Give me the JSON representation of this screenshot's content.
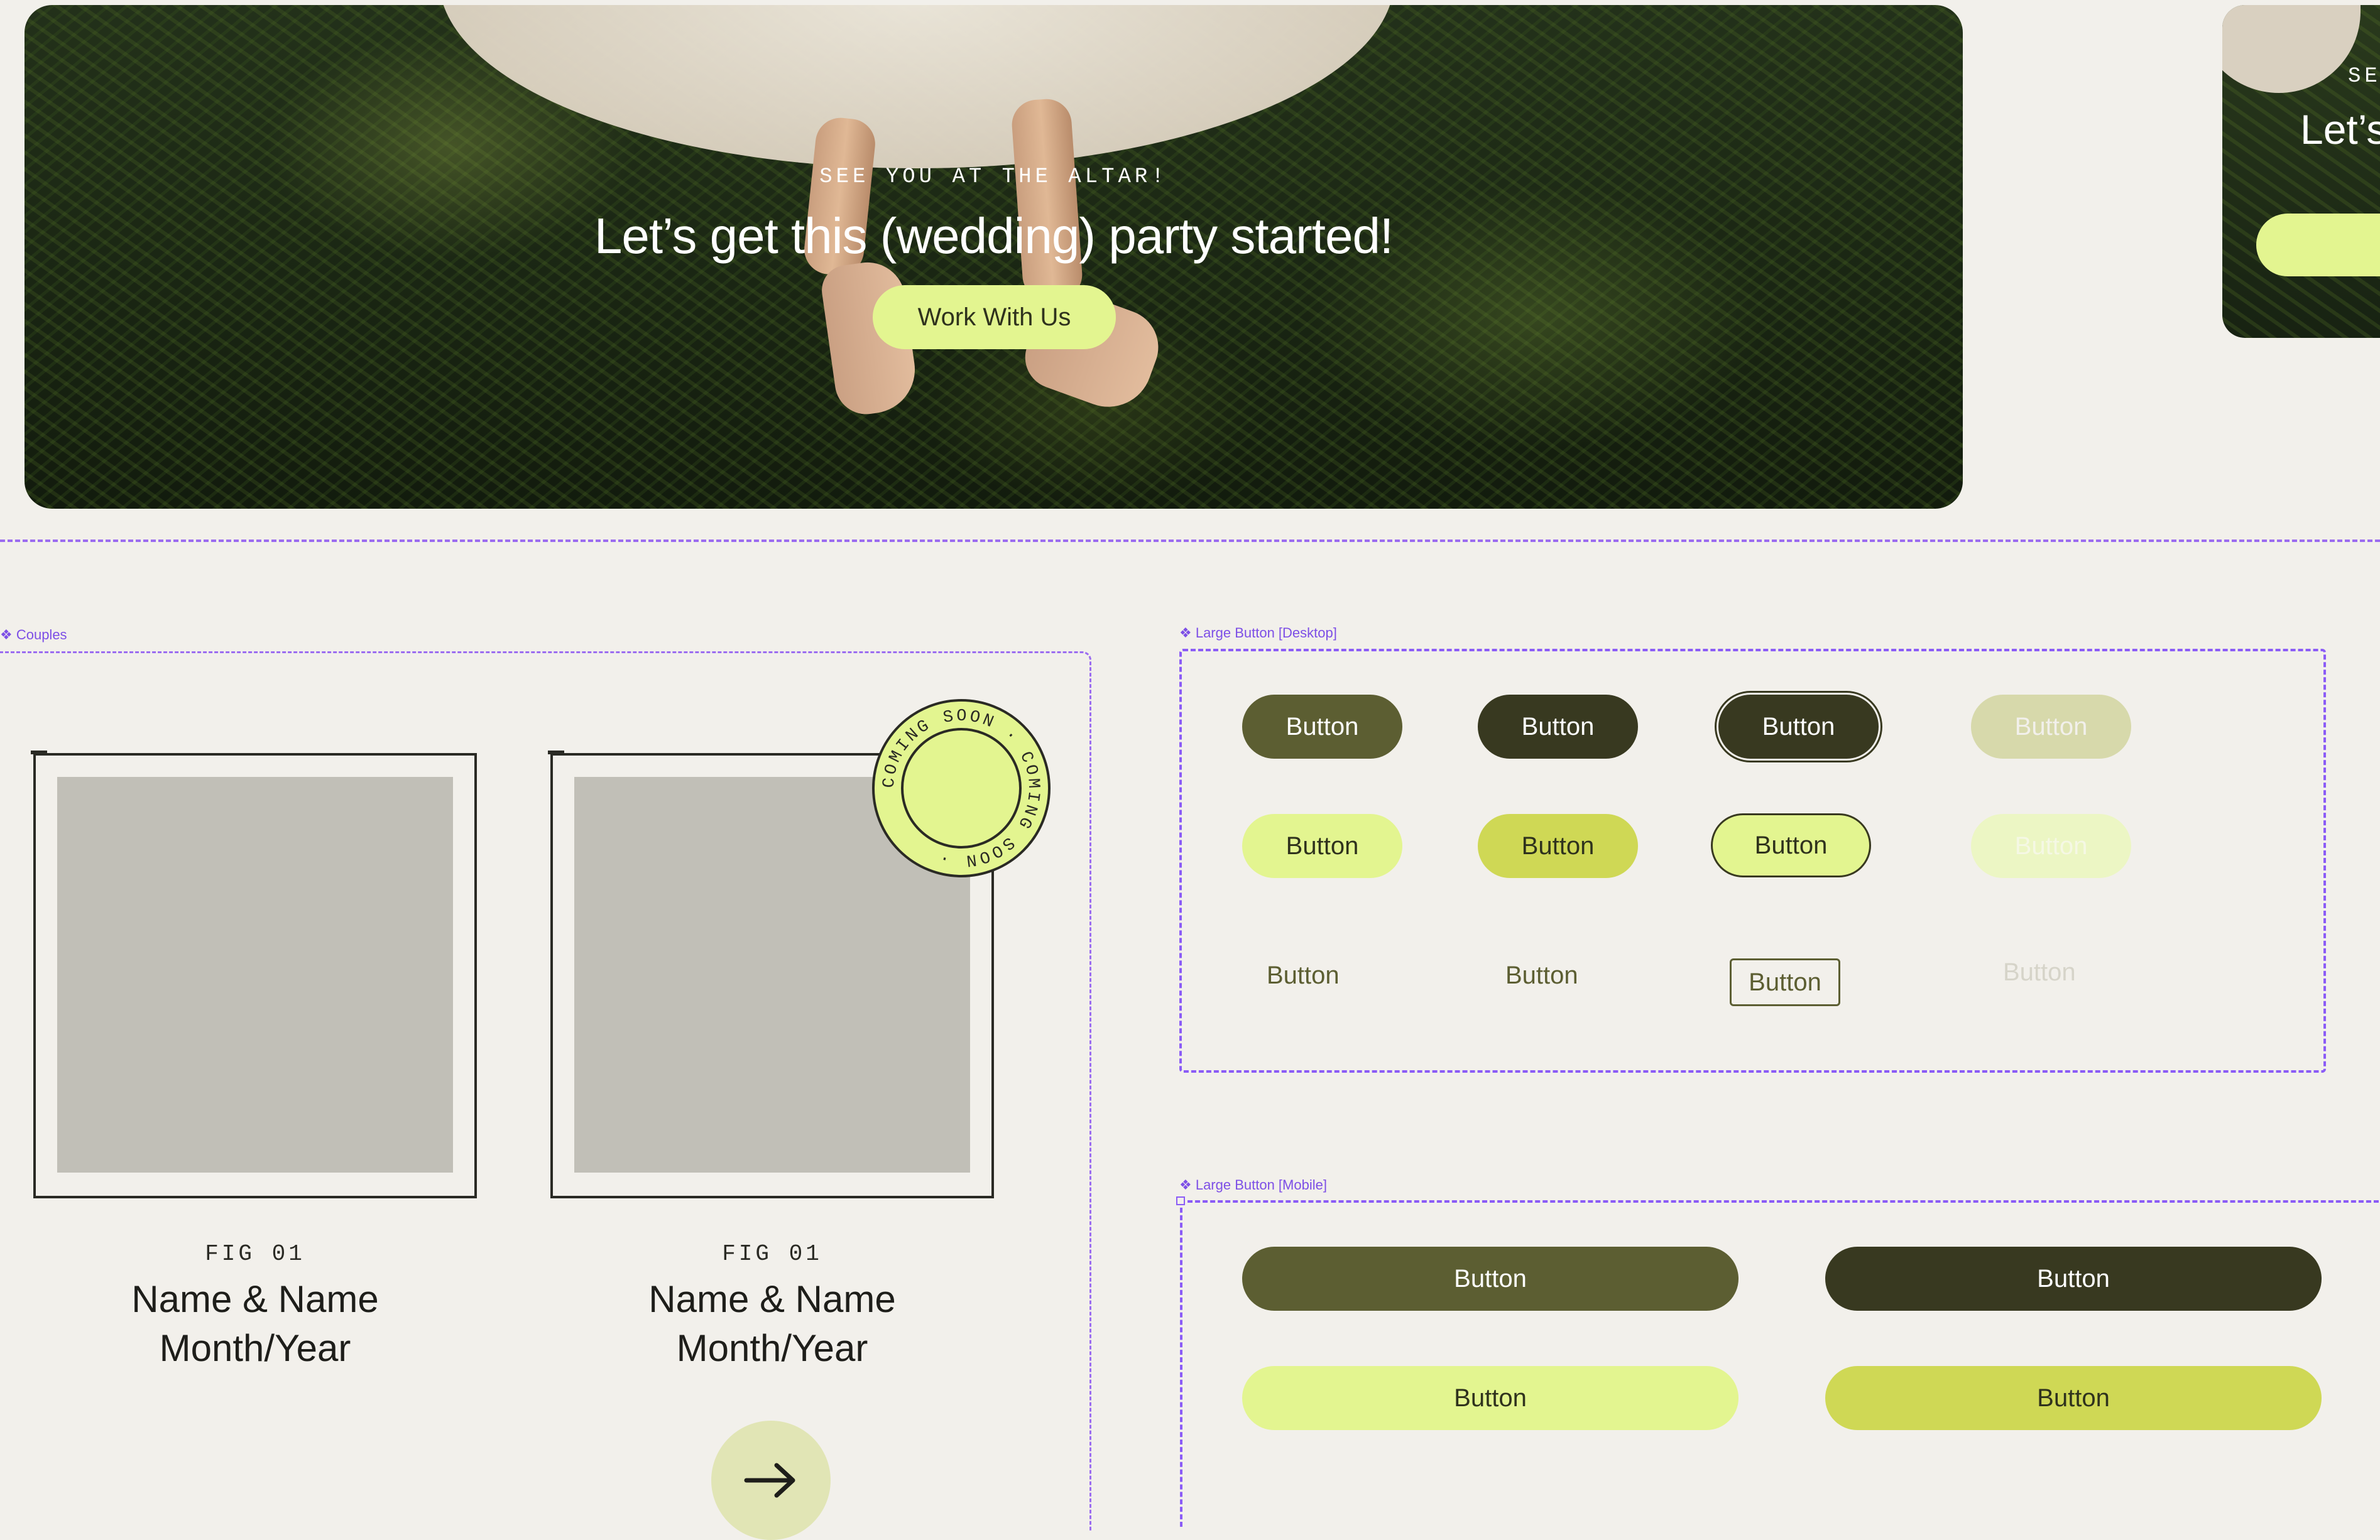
{
  "hero": {
    "eyebrow": "SEE YOU AT THE ALTAR!",
    "title": "Let’s get this (wedding) party started!",
    "cta_label": "Work With Us"
  },
  "hero_partial": {
    "eyebrow": "SEE",
    "title": "Let’s"
  },
  "frames": {
    "couples_label": "❖ Couples",
    "large_desktop_label": "❖ Large Button [Desktop]",
    "large_mobile_label": "❖ Large Button [Mobile]"
  },
  "couples": [
    {
      "fig": "FIG 01",
      "name": "Name & Name",
      "date": "Month/Year"
    },
    {
      "fig": "FIG 01",
      "name": "Name & Name",
      "date": "Month/Year"
    }
  ],
  "badge": {
    "text": "COMING SOON · COMING SOON ·"
  },
  "arrow_icon": "arrow-right-icon",
  "button_label": "Button",
  "colors": {
    "olive": "#5c5e32",
    "dark_olive": "#383920",
    "lime": "#e3f590",
    "lime_dark": "#cfd855",
    "frame_purple": "#8b5cf6",
    "background": "#f2f0eb"
  }
}
